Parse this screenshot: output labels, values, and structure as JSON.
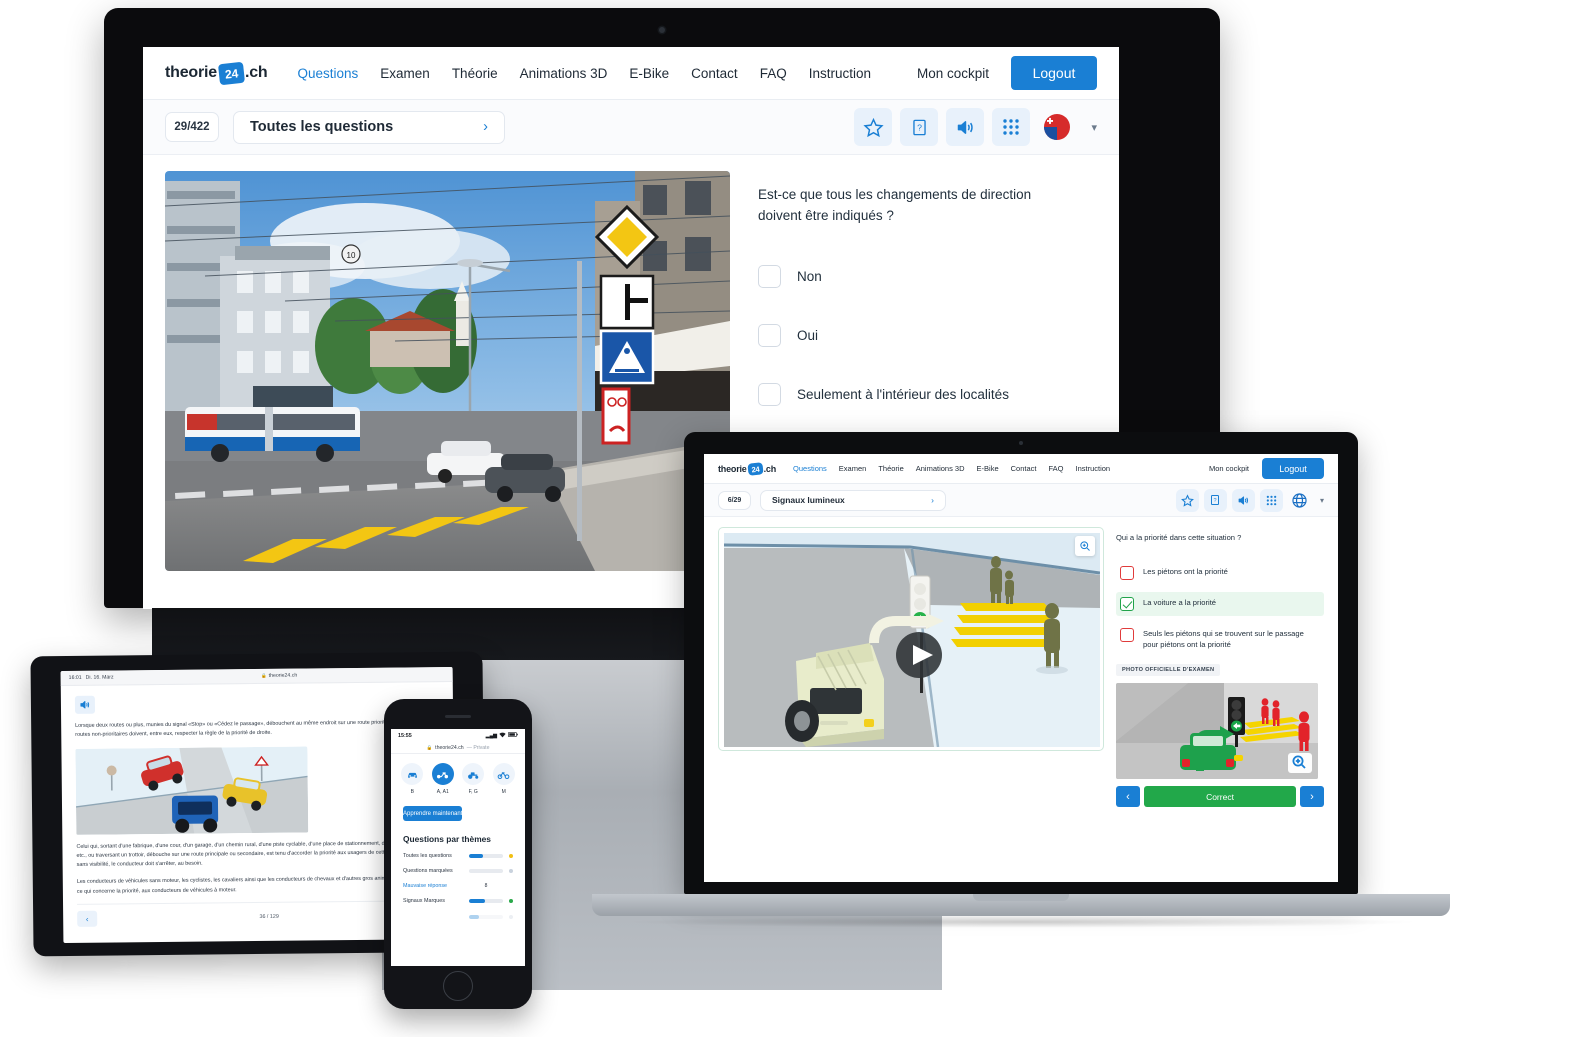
{
  "brand": {
    "name_left": "theorie",
    "badge": "24",
    "name_right": ".ch",
    "accent": "#1a7fd4",
    "correct_color": "#22a84a",
    "wrong_color": "#e03b3b"
  },
  "desktop": {
    "nav": [
      {
        "label": "Questions",
        "active": true
      },
      {
        "label": "Examen",
        "active": false
      },
      {
        "label": "Théorie",
        "active": false
      },
      {
        "label": "Animations 3D",
        "active": false
      },
      {
        "label": "E-Bike",
        "active": false
      },
      {
        "label": "Contact",
        "active": false
      },
      {
        "label": "FAQ",
        "active": false
      },
      {
        "label": "Instruction",
        "active": false
      }
    ],
    "cockpit_label": "Mon cockpit",
    "logout_label": "Logout",
    "counter": "29/422",
    "selector_label": "Toutes les questions",
    "selector_chevron": "›",
    "icons": [
      {
        "name": "star-icon",
        "glyph": "☆"
      },
      {
        "name": "help-book-icon",
        "glyph": "?"
      },
      {
        "name": "sound-icon",
        "glyph": "🔊"
      },
      {
        "name": "grid-icon",
        "glyph": "⣿"
      },
      {
        "name": "flag-ch-fr-icon",
        "glyph": ""
      }
    ],
    "language_caret": "▾",
    "question": "Est-ce que tous les changements de direction doivent être indiqués ?",
    "answers": [
      {
        "label": "Non",
        "state": "unchecked"
      },
      {
        "label": "Oui",
        "state": "unchecked"
      },
      {
        "label": "Seulement à l'intérieur des localités",
        "state": "unchecked"
      }
    ],
    "photo_alt": "Intersection urbaine avec bus, voitures, passage piétons jaune et signaux routiers"
  },
  "laptop": {
    "nav": [
      {
        "label": "Questions",
        "active": true
      },
      {
        "label": "Examen",
        "active": false
      },
      {
        "label": "Théorie",
        "active": false
      },
      {
        "label": "Animations 3D",
        "active": false
      },
      {
        "label": "E-Bike",
        "active": false
      },
      {
        "label": "Contact",
        "active": false
      },
      {
        "label": "FAQ",
        "active": false
      },
      {
        "label": "Instruction",
        "active": false
      }
    ],
    "cockpit_label": "Mon cockpit",
    "logout_label": "Logout",
    "counter": "6/29",
    "selector_label": "Signaux lumineux",
    "selector_chevron": "›",
    "icons": [
      {
        "name": "star-icon",
        "glyph": "☆"
      },
      {
        "name": "help-book-icon",
        "glyph": "?"
      },
      {
        "name": "sound-icon",
        "glyph": "🔊"
      },
      {
        "name": "grid-icon",
        "glyph": "⣿"
      },
      {
        "name": "globe-icon",
        "glyph": "🌐"
      }
    ],
    "language_caret": "▾",
    "question": "Qui a la priorité dans cette situation ?",
    "answers": [
      {
        "label": "Les piétons ont la priorité",
        "state": "wrong"
      },
      {
        "label": "La voiture a la priorité",
        "state": "right"
      },
      {
        "label": "Seuls les piétons qui se trouvent sur le passage pour piétons ont la priorité",
        "state": "wrong"
      }
    ],
    "photo_badge": "PHOTO OFFICIELLE D'EXAMEN",
    "prev_label": "‹",
    "next_label": "›",
    "result_label": "Correct",
    "play_label": "▶",
    "zoom_label": "⊕"
  },
  "tablet": {
    "status_time": "16:01",
    "status_date": "Di. 16. März",
    "url": "theorie24.ch",
    "lock_glyph": "🔒",
    "sound_icon": "🔊",
    "paragraphs": [
      "Lorsque deux routes ou plus, munies du signal «Stop» ou «Cédez le passage», débouchent au même endroit sur une route prioritaire, les usagers des routes non-prioritaires doivent, entre eux, respecter la règle de la priorité de droite.",
      "Celui qui, sortant d'une fabrique, d'une cour, d'un garage, d'un chemin rural, d'une piste cyclable, d'une place de stationnement, d'une station d'essence, etc., ou traversant un trottoir, débouche sur une route principale ou secondaire, est tenu d'accorder la priorité aux usagers de cette route. S'il endroit est sans visibilité, le conducteur doit s'arrêter, au besoin.",
      "Les conducteurs de véhicules sans moteur, les cyclistes, les cavaliers ainsi que les conducteurs de chevaux et d'autres gros animaux sont assimilés, en ce qui concerne la priorité, aux conducteurs de véhicules à moteur."
    ],
    "prev_label": "‹",
    "page_indicator": "36 / 129"
  },
  "phone": {
    "status_time": "15:55",
    "signal_glyph": "▂▄▆",
    "wifi_glyph": "▼",
    "battery_glyph": "▰",
    "url": "theorie24.ch",
    "private_label": "— Private",
    "lock_glyph": "🔒",
    "categories": [
      {
        "label": "B",
        "icon": "car-icon",
        "glyph": "🚗",
        "selected": false
      },
      {
        "label": "A, A1",
        "icon": "motorcycle-icon",
        "glyph": "🏍",
        "selected": true
      },
      {
        "label": "F, G",
        "icon": "tractor-icon",
        "glyph": "🚜",
        "selected": false
      },
      {
        "label": "M",
        "icon": "moped-icon",
        "glyph": "🛵",
        "selected": false
      }
    ],
    "cta_label": "Apprendre maintenant",
    "section_title": "Questions par thèmes",
    "themes": [
      {
        "label": "Toutes les questions",
        "progress": 42,
        "dot_color": "#f2c014",
        "value": ""
      },
      {
        "label": "Questions marquées",
        "progress": 0,
        "dot_color": "#c9d2dd",
        "value": ""
      },
      {
        "label": "Mauvaise réponse",
        "progress": -1,
        "dot_color": "",
        "value": "8",
        "is_link": true
      },
      {
        "label": "Signaux Marques",
        "progress": 48,
        "dot_color": "#2aa84a",
        "value": ""
      }
    ]
  }
}
